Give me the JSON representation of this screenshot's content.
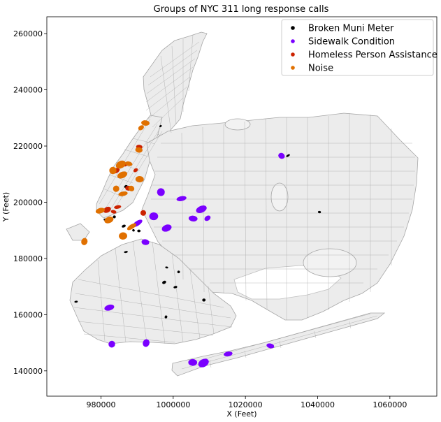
{
  "chart_data": {
    "type": "map",
    "title": "Groups of NYC 311 long response calls",
    "xlabel": "X (Feet)",
    "ylabel": "Y (Feet)",
    "xlim": [
      965000,
      1073000
    ],
    "ylim": [
      131000,
      266000
    ],
    "xticks": [
      980000,
      1000000,
      1020000,
      1040000,
      1060000
    ],
    "xtick_labels": [
      "980000",
      "1000000",
      "1020000",
      "1040000",
      "1060000"
    ],
    "yticks": [
      140000,
      160000,
      180000,
      200000,
      220000,
      240000,
      260000
    ],
    "ytick_labels": [
      "140000",
      "160000",
      "180000",
      "200000",
      "220000",
      "240000",
      "260000"
    ],
    "legend_position": "top-right",
    "base_map": {
      "name": "NYC street network",
      "stroke_color": "#8c8c8c",
      "fill_color": "#e8e8e8"
    },
    "series": [
      {
        "name": "Broken Muni Meter",
        "color": "#000000",
        "clusters": [
          [
            996500,
            227100
          ],
          [
            981200,
            193800
          ],
          [
            986300,
            191500
          ],
          [
            983700,
            194800
          ],
          [
            986900,
            182300
          ],
          [
            989000,
            190000
          ],
          [
            990500,
            189800
          ],
          [
            997500,
            171500
          ],
          [
            998200,
            176800
          ],
          [
            1000600,
            169800
          ],
          [
            1001500,
            175200
          ],
          [
            1008500,
            165200
          ],
          [
            1031800,
            216600
          ],
          [
            1040500,
            196500
          ],
          [
            986900,
            205600
          ],
          [
            998000,
            159200
          ],
          [
            973100,
            164600
          ]
        ]
      },
      {
        "name": "Sidewalk Condition",
        "color": "#7a00ff",
        "clusters": [
          [
            1009500,
            194300
          ],
          [
            1005500,
            194200
          ],
          [
            1007800,
            197500
          ],
          [
            996600,
            203600
          ],
          [
            1002300,
            201300
          ],
          [
            1030000,
            216500
          ],
          [
            1005400,
            143000
          ],
          [
            1008400,
            142800
          ],
          [
            1026900,
            148900
          ],
          [
            982300,
            162500
          ],
          [
            983000,
            149500
          ],
          [
            994600,
            195000
          ],
          [
            990100,
            192500
          ],
          [
            992300,
            185800
          ],
          [
            998200,
            190800
          ],
          [
            992500,
            149900
          ],
          [
            1015200,
            146000
          ]
        ]
      },
      {
        "name": "Homeless Person Assistance",
        "color": "#cc2200",
        "clusters": [
          [
            989600,
            211400
          ],
          [
            990600,
            219700
          ],
          [
            984100,
            211200
          ],
          [
            991700,
            196200
          ],
          [
            984600,
            198300
          ],
          [
            986600,
            213500
          ],
          [
            987600,
            205000
          ],
          [
            981700,
            197300
          ],
          [
            983500,
            196600
          ]
        ]
      },
      {
        "name": "Noise",
        "color": "#e07000",
        "clusters": [
          [
            991100,
            226500
          ],
          [
            992300,
            228200
          ],
          [
            985900,
            209700
          ],
          [
            983300,
            211300
          ],
          [
            986100,
            203000
          ],
          [
            988400,
            204900
          ],
          [
            990700,
            208200
          ],
          [
            985500,
            213400
          ],
          [
            987700,
            213700
          ],
          [
            979800,
            197000
          ],
          [
            984200,
            204800
          ],
          [
            986100,
            188000
          ],
          [
            988500,
            191300
          ],
          [
            990500,
            218600
          ],
          [
            982200,
            193700
          ],
          [
            975400,
            186000
          ]
        ]
      }
    ]
  }
}
